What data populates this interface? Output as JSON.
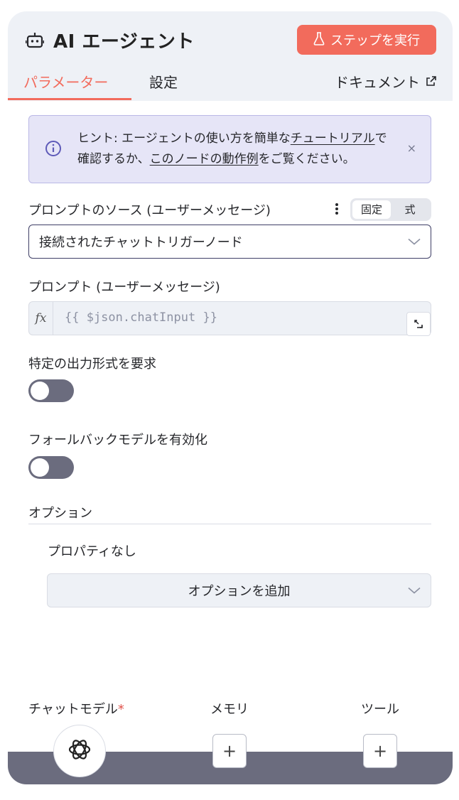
{
  "header": {
    "title": "AI エージェント",
    "run_button": "ステップを実行",
    "tabs": {
      "parameters": "パラメーター",
      "settings": "設定",
      "docs": "ドキュメント"
    }
  },
  "hint": {
    "prefix": "ヒント: エージェントの使い方を簡単な",
    "link1": "チュートリアル",
    "middle": "で確認するか、",
    "link2": "このノードの動作例",
    "suffix": "をご覧ください。",
    "close": "×"
  },
  "prompt_source": {
    "label": "プロンプトのソース (ユーザーメッセージ)",
    "mode_fixed": "固定",
    "mode_expression": "式",
    "value": "接続されたチャットトリガーノード"
  },
  "prompt": {
    "label": "プロンプト (ユーザーメッセージ)",
    "fx": "fx",
    "expression": "{{ $json.chatInput }}"
  },
  "output_format": {
    "label": "特定の出力形式を要求",
    "enabled": false
  },
  "fallback_model": {
    "label": "フォールバックモデルを有効化",
    "enabled": false
  },
  "options": {
    "label": "オプション",
    "empty_text": "プロパティなし",
    "add_button": "オプションを追加"
  },
  "connectors": {
    "chat_model": "チャットモデル",
    "required_mark": "*",
    "memory": "メモリ",
    "tools": "ツール",
    "plus": "+"
  },
  "colors": {
    "accent": "#f26b5c",
    "header_bg": "#eef1f6",
    "hint_bg": "#e6e5f7",
    "switch_off": "#6b6c7e"
  }
}
